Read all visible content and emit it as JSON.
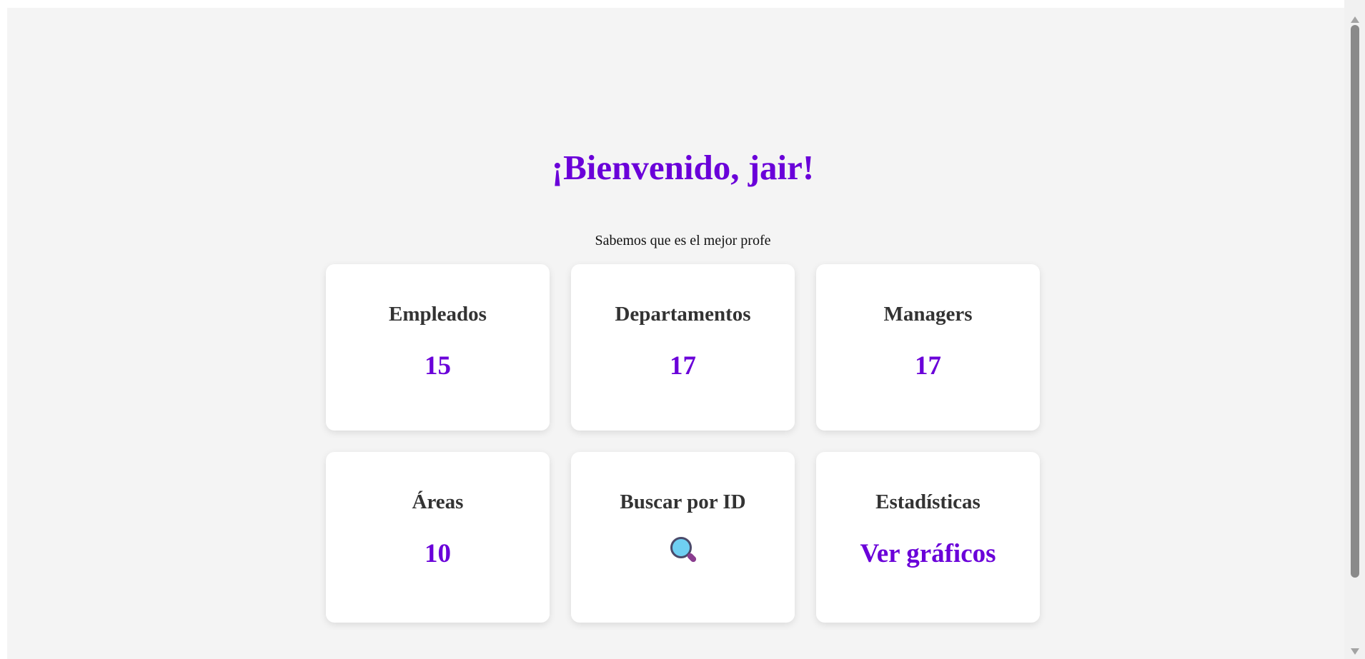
{
  "header": {
    "welcome": "¡Bienvenido, jair!",
    "subtitle": "Sabemos que es el mejor profe"
  },
  "cards": [
    {
      "title": "Empleados",
      "value": "15"
    },
    {
      "title": "Departamentos",
      "value": "17"
    },
    {
      "title": "Managers",
      "value": "17"
    },
    {
      "title": "Áreas",
      "value": "10"
    },
    {
      "title": "Buscar por ID",
      "icon": "search-icon"
    },
    {
      "title": "Estadísticas",
      "value": "Ver gráficos"
    }
  ],
  "colors": {
    "accent": "#6a00d9",
    "card_title": "#333333",
    "background": "#f4f4f4"
  }
}
